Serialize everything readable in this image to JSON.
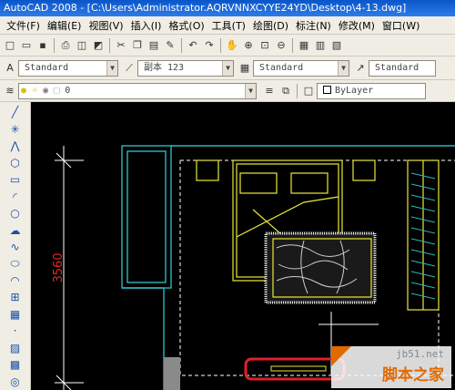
{
  "window": {
    "title": "AutoCAD 2008 - [C:\\Users\\Administrator.AQRVNNXCYYE24YD\\Desktop\\4-13.dwg]"
  },
  "menu": {
    "items": [
      "文件(F)",
      "编辑(E)",
      "视图(V)",
      "插入(I)",
      "格式(O)",
      "工具(T)",
      "绘图(D)",
      "标注(N)",
      "修改(M)",
      "窗口(W)"
    ]
  },
  "styles_toolbar": {
    "text_style": "Standard",
    "dim_style": "副本 123",
    "table_style": "Standard",
    "multileader_style": "Standard"
  },
  "layers_toolbar": {
    "layer_value": "0",
    "color_value": "ByLayer"
  },
  "drawing": {
    "dimension_text": "3560",
    "colors": {
      "wall": "#2bb8c0",
      "furniture": "#e8e83a",
      "dimension": "#ffffff",
      "dim_text": "#e02828",
      "highlight": "#e0202a",
      "hatch": "#e8e8e8"
    }
  },
  "watermark": {
    "site": "jb51.net",
    "name": "脚本之家"
  }
}
